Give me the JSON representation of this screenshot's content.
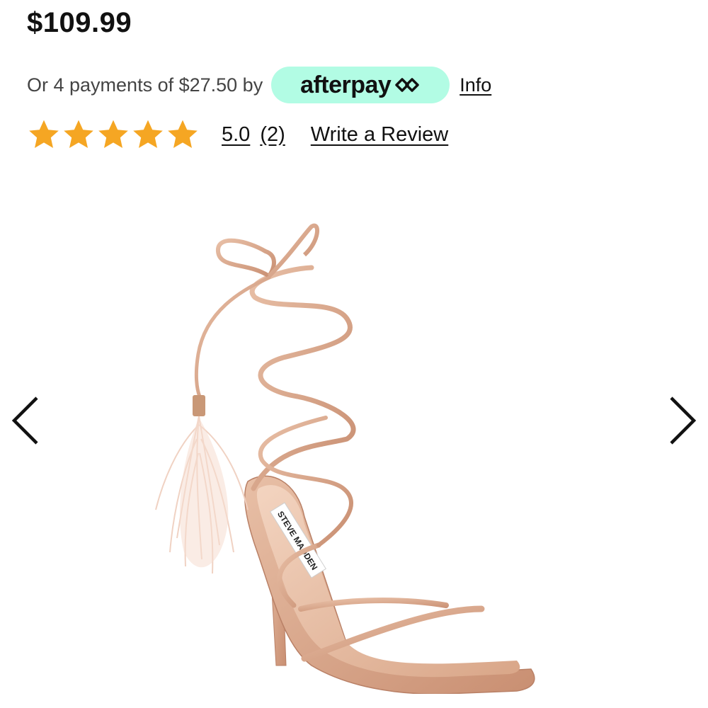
{
  "product": {
    "price": "$109.99"
  },
  "payment": {
    "installment_text": "Or 4 payments of $27.50 by",
    "provider_name": "afterpay",
    "provider_color": "#b2fce4",
    "info_label": "Info"
  },
  "rating": {
    "stars": 5,
    "star_color": "#f5a623",
    "value": "5.0",
    "count": "(2)",
    "write_review_label": "Write a Review"
  },
  "carousel": {
    "prev_icon": "chevron-left-icon",
    "next_icon": "chevron-right-icon",
    "image_brand_label": "STEVE MADDEN"
  }
}
